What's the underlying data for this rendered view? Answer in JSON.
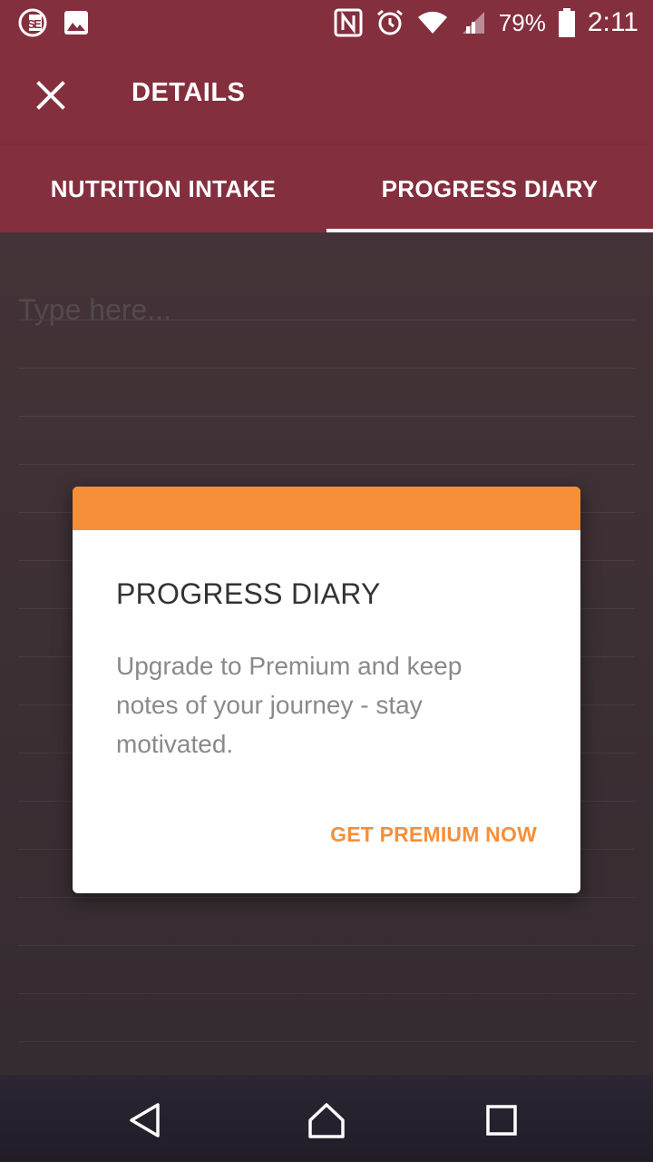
{
  "status_bar": {
    "battery_percent": "79%",
    "time": "2:11",
    "icons": [
      "carrier-app-icon",
      "image-notification-icon",
      "nfc-icon",
      "alarm-icon",
      "wifi-icon",
      "cellular-signal-icon",
      "battery-icon"
    ]
  },
  "app_bar": {
    "title": "DETAILS",
    "close_icon": "close-icon"
  },
  "tabs": [
    {
      "label": "NUTRITION INTAKE",
      "selected": false
    },
    {
      "label": "PROGRESS DIARY",
      "selected": true
    }
  ],
  "diary": {
    "placeholder": "Type here..."
  },
  "dialog": {
    "title": "PROGRESS DIARY",
    "message": "Upgrade to Premium and keep notes of your journey - stay motivated.",
    "action_label": "GET PREMIUM NOW",
    "accent_color": "#f78f38"
  },
  "nav_bar": {
    "icons": [
      "back-icon",
      "home-icon",
      "recents-icon"
    ]
  },
  "colors": {
    "primary": "#842f3e",
    "accent": "#f78f38"
  }
}
